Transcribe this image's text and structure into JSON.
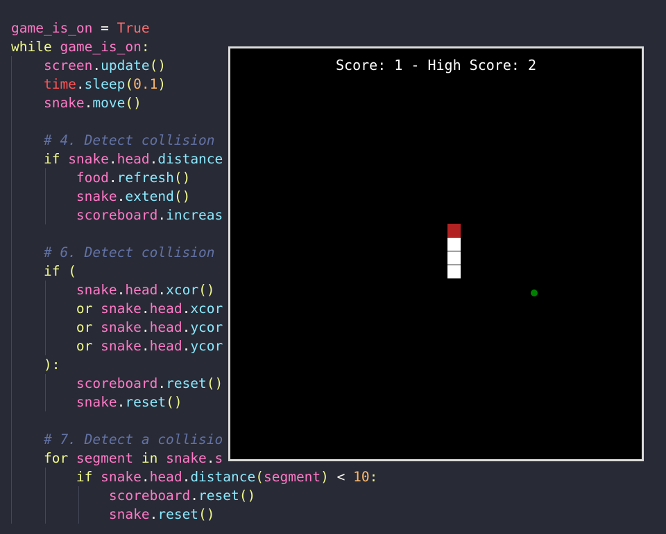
{
  "theme": {
    "background": "#282a36",
    "pink": "#ff79c6",
    "yellow": "#f1fa8c",
    "cyan": "#8be9fd",
    "orange": "#ffb86c",
    "salmon": "#ff6e6e",
    "comment": "#6272a4",
    "plain": "#f8f8f2"
  },
  "code_lines": [
    [
      {
        "t": "game_is_on",
        "c": "pink"
      },
      {
        "t": " = ",
        "c": "plain"
      },
      {
        "t": "True",
        "c": "salmon"
      }
    ],
    [
      {
        "t": "while ",
        "c": "yellow"
      },
      {
        "t": "game_is_on",
        "c": "pink"
      },
      {
        "t": ":",
        "c": "yellow"
      }
    ],
    [
      {
        "t": "    screen",
        "c": "pink"
      },
      {
        "t": ".",
        "c": "plain"
      },
      {
        "t": "update",
        "c": "cyan"
      },
      {
        "t": "()",
        "c": "yellow"
      }
    ],
    [
      {
        "t": "    time",
        "c": "red"
      },
      {
        "t": ".",
        "c": "plain"
      },
      {
        "t": "sleep",
        "c": "cyan"
      },
      {
        "t": "(",
        "c": "yellow"
      },
      {
        "t": "0.1",
        "c": "orange"
      },
      {
        "t": ")",
        "c": "yellow"
      }
    ],
    [
      {
        "t": "    snake",
        "c": "pink"
      },
      {
        "t": ".",
        "c": "plain"
      },
      {
        "t": "move",
        "c": "cyan"
      },
      {
        "t": "()",
        "c": "yellow"
      }
    ],
    [],
    [
      {
        "t": "    # 4. Detect collision",
        "c": "comment"
      }
    ],
    [
      {
        "t": "    if ",
        "c": "yellow"
      },
      {
        "t": "snake",
        "c": "pink"
      },
      {
        "t": ".",
        "c": "plain"
      },
      {
        "t": "head",
        "c": "pink"
      },
      {
        "t": ".",
        "c": "plain"
      },
      {
        "t": "distance",
        "c": "cyan"
      }
    ],
    [
      {
        "t": "        food",
        "c": "pink"
      },
      {
        "t": ".",
        "c": "plain"
      },
      {
        "t": "refresh",
        "c": "cyan"
      },
      {
        "t": "()",
        "c": "yellow"
      }
    ],
    [
      {
        "t": "        snake",
        "c": "pink"
      },
      {
        "t": ".",
        "c": "plain"
      },
      {
        "t": "extend",
        "c": "cyan"
      },
      {
        "t": "()",
        "c": "yellow"
      }
    ],
    [
      {
        "t": "        scoreboard",
        "c": "pink"
      },
      {
        "t": ".",
        "c": "plain"
      },
      {
        "t": "increas",
        "c": "cyan"
      }
    ],
    [],
    [
      {
        "t": "    # 6. Detect collision",
        "c": "comment"
      }
    ],
    [
      {
        "t": "    if ",
        "c": "yellow"
      },
      {
        "t": "(",
        "c": "yellow"
      }
    ],
    [
      {
        "t": "        snake",
        "c": "pink"
      },
      {
        "t": ".",
        "c": "plain"
      },
      {
        "t": "head",
        "c": "pink"
      },
      {
        "t": ".",
        "c": "plain"
      },
      {
        "t": "xcor",
        "c": "cyan"
      },
      {
        "t": "()",
        "c": "yellow"
      }
    ],
    [
      {
        "t": "        or ",
        "c": "yellow"
      },
      {
        "t": "snake",
        "c": "pink"
      },
      {
        "t": ".",
        "c": "plain"
      },
      {
        "t": "head",
        "c": "pink"
      },
      {
        "t": ".",
        "c": "plain"
      },
      {
        "t": "xcor",
        "c": "cyan"
      }
    ],
    [
      {
        "t": "        or ",
        "c": "yellow"
      },
      {
        "t": "snake",
        "c": "pink"
      },
      {
        "t": ".",
        "c": "plain"
      },
      {
        "t": "head",
        "c": "pink"
      },
      {
        "t": ".",
        "c": "plain"
      },
      {
        "t": "ycor",
        "c": "cyan"
      }
    ],
    [
      {
        "t": "        or ",
        "c": "yellow"
      },
      {
        "t": "snake",
        "c": "pink"
      },
      {
        "t": ".",
        "c": "plain"
      },
      {
        "t": "head",
        "c": "pink"
      },
      {
        "t": ".",
        "c": "plain"
      },
      {
        "t": "ycor",
        "c": "cyan"
      }
    ],
    [
      {
        "t": "    )",
        "c": "yellow"
      },
      {
        "t": ":",
        "c": "yellow"
      }
    ],
    [
      {
        "t": "        scoreboard",
        "c": "pink"
      },
      {
        "t": ".",
        "c": "plain"
      },
      {
        "t": "reset",
        "c": "cyan"
      },
      {
        "t": "()",
        "c": "yellow"
      }
    ],
    [
      {
        "t": "        snake",
        "c": "pink"
      },
      {
        "t": ".",
        "c": "plain"
      },
      {
        "t": "reset",
        "c": "cyan"
      },
      {
        "t": "()",
        "c": "yellow"
      }
    ],
    [],
    [
      {
        "t": "    # 7. Detect a collisio",
        "c": "comment"
      }
    ],
    [
      {
        "t": "    for ",
        "c": "yellow"
      },
      {
        "t": "segment ",
        "c": "pink"
      },
      {
        "t": "in ",
        "c": "yellow"
      },
      {
        "t": "snake",
        "c": "pink"
      },
      {
        "t": ".",
        "c": "plain"
      },
      {
        "t": "s",
        "c": "pink"
      }
    ],
    [
      {
        "t": "        if ",
        "c": "yellow"
      },
      {
        "t": "snake",
        "c": "pink"
      },
      {
        "t": ".",
        "c": "plain"
      },
      {
        "t": "head",
        "c": "pink"
      },
      {
        "t": ".",
        "c": "plain"
      },
      {
        "t": "distance",
        "c": "cyan"
      },
      {
        "t": "(",
        "c": "yellow"
      },
      {
        "t": "segment",
        "c": "pink"
      },
      {
        "t": ")",
        "c": "yellow"
      },
      {
        "t": " < ",
        "c": "plain"
      },
      {
        "t": "10",
        "c": "orange"
      },
      {
        "t": ":",
        "c": "yellow"
      }
    ],
    [
      {
        "t": "            scoreboard",
        "c": "pink"
      },
      {
        "t": ".",
        "c": "plain"
      },
      {
        "t": "reset",
        "c": "cyan"
      },
      {
        "t": "()",
        "c": "yellow"
      }
    ],
    [
      {
        "t": "            snake",
        "c": "pink"
      },
      {
        "t": ".",
        "c": "plain"
      },
      {
        "t": "reset",
        "c": "cyan"
      },
      {
        "t": "()",
        "c": "yellow"
      }
    ]
  ],
  "game": {
    "score_text": "Score: 1 - High Score: 2",
    "canvas_color": "#000000",
    "frame_color": "#dcdcdc",
    "head_color": "#b22222",
    "body_color": "#ffffff",
    "food_color": "#008000"
  }
}
